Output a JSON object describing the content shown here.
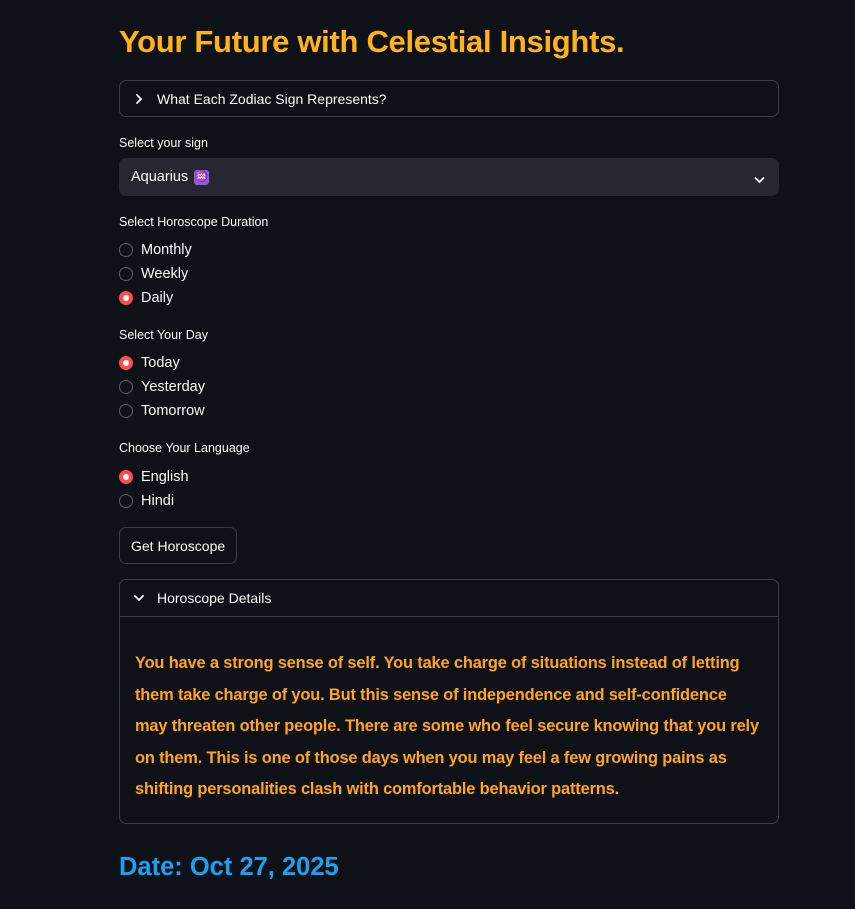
{
  "title": "Your Future with Celestial Insights.",
  "zodiac_expander": {
    "label": "What Each Zodiac Sign Represents?",
    "expanded": false
  },
  "sign_select": {
    "label": "Select your sign",
    "value": "Aquarius",
    "glyph": "♒",
    "glyph_color": "#8e5ad7"
  },
  "duration": {
    "label": "Select Horoscope Duration",
    "options": [
      "Monthly",
      "Weekly",
      "Daily"
    ],
    "selected": "Daily"
  },
  "day": {
    "label": "Select Your Day",
    "options": [
      "Today",
      "Yesterday",
      "Tomorrow"
    ],
    "selected": "Today"
  },
  "language": {
    "label": "Choose Your Language",
    "options": [
      "English",
      "Hindi"
    ],
    "selected": "English"
  },
  "get_button": {
    "label": "Get Horoscope"
  },
  "details": {
    "label": "Horoscope Details",
    "expanded": true,
    "text": "You have a strong sense of self. You take charge of situations instead of letting them take charge of you. But this sense of independence and self-confidence may threaten other people. There are some who feel secure knowing that you rely on them. This is one of those days when you may feel a few growing pains as shifting personalities clash with comfortable behavior patterns."
  },
  "date": {
    "text": "Date: Oct 27, 2025"
  },
  "colors": {
    "background": "#0e1117",
    "title": "#ffb31a",
    "horoscope_text": "#ffa421",
    "date_text": "#1ca0f2",
    "radio_accent": "#ff4b4b",
    "select_bg": "#262730",
    "border": "#3a3d47"
  }
}
